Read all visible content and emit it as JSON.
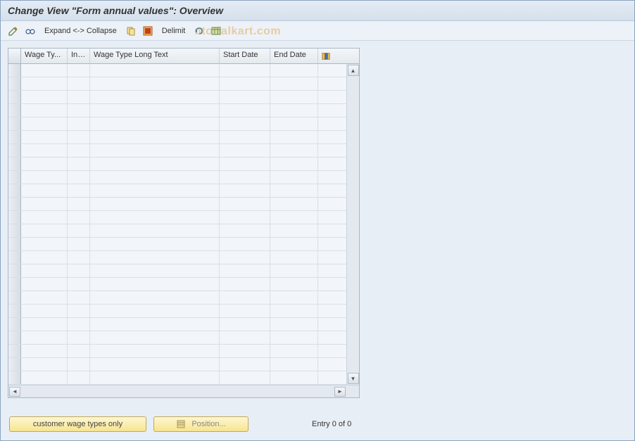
{
  "title": "Change View \"Form annual values\": Overview",
  "toolbar": {
    "expand_collapse_label": "Expand <-> Collapse",
    "delimit_label": "Delimit"
  },
  "table": {
    "columns": {
      "wage_ty": "Wage Ty...",
      "inf": "Inf...",
      "long_text": "Wage Type Long Text",
      "start_date": "Start Date",
      "end_date": "End Date"
    },
    "row_count": 24
  },
  "buttons": {
    "customer_label": "customer wage types only",
    "position_label": "Position..."
  },
  "status": {
    "entry_text": "Entry 0 of 0"
  },
  "watermark": "utorialkart.com"
}
